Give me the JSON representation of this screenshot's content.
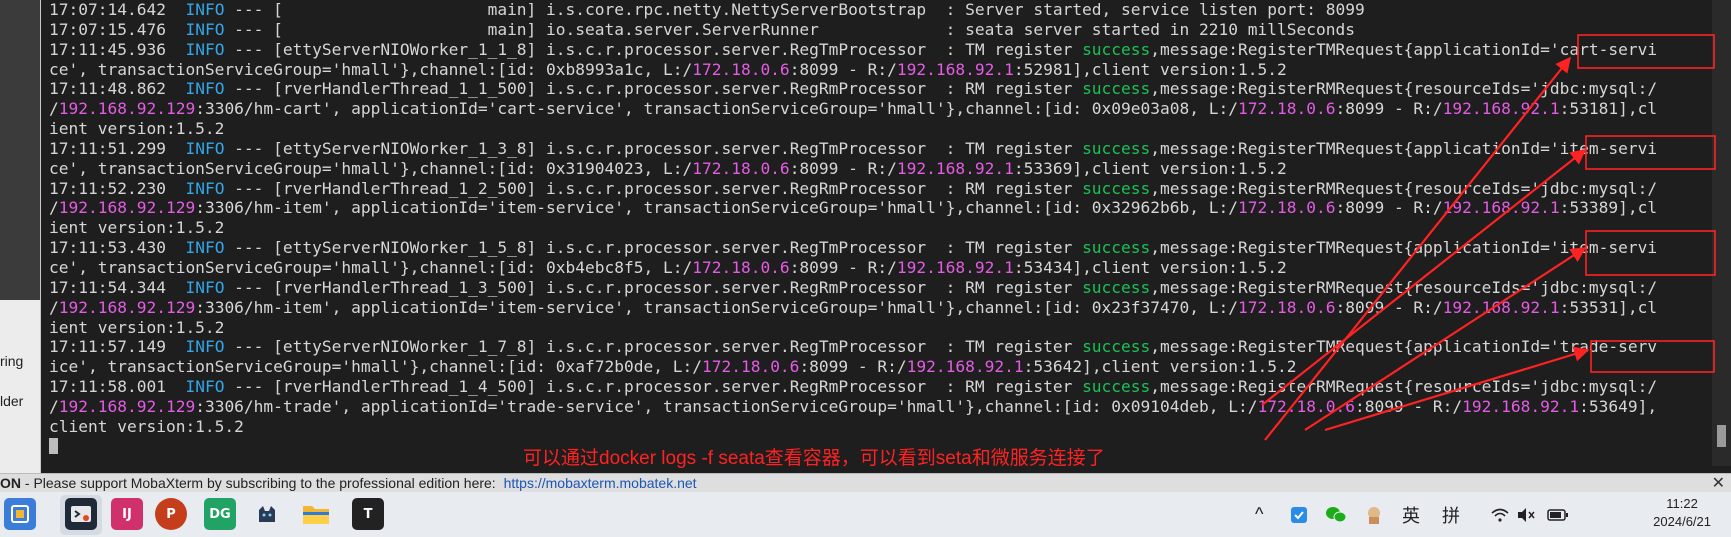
{
  "sidebar": {
    "items": [
      {
        "label": "ring"
      },
      {
        "label": "lder"
      }
    ]
  },
  "terminal": {
    "lines": [
      [
        {
          "t": "17:07:14.642  "
        },
        {
          "t": "INFO",
          "c": "info"
        },
        {
          "t": " --- [                     main] i.s.core.rpc.netty.NettyServerBootstrap  : Server started, service listen port: 8099"
        }
      ],
      [
        {
          "t": "17:07:15.476  "
        },
        {
          "t": "INFO",
          "c": "info"
        },
        {
          "t": " --- [                     main] io.seata.server.ServerRunner             : seata server started in 2210 millSeconds"
        }
      ],
      [
        {
          "t": "17:11:45.936  "
        },
        {
          "t": "INFO",
          "c": "info"
        },
        {
          "t": " --- [ettyServerNIOWorker_1_1_8] i.s.c.r.processor.server.RegTmProcessor  : TM register "
        },
        {
          "t": "success",
          "c": "ok"
        },
        {
          "t": ",message:RegisterTMRequest{applicationId='cart-servi"
        }
      ],
      [
        {
          "t": "ce', transactionServiceGroup='hmall'},channel:[id: 0xb8993a1c, L:/"
        },
        {
          "t": "172.18.0.6",
          "c": "ip"
        },
        {
          "t": ":8099 - R:/"
        },
        {
          "t": "192.168.92.1",
          "c": "ip"
        },
        {
          "t": ":52981],client version:1.5.2"
        }
      ],
      [
        {
          "t": "17:11:48.862  "
        },
        {
          "t": "INFO",
          "c": "info"
        },
        {
          "t": " --- [rverHandlerThread_1_1_500] i.s.c.r.processor.server.RegRmProcessor  : RM register "
        },
        {
          "t": "success",
          "c": "ok"
        },
        {
          "t": ",message:RegisterRMRequest{resourceIds='jdbc:mysql:/"
        }
      ],
      [
        {
          "t": "/"
        },
        {
          "t": "192.168.92.129",
          "c": "ip"
        },
        {
          "t": ":3306/hm-cart', applicationId='cart-service', transactionServiceGroup='hmall'},channel:[id: 0x09e03a08, L:/"
        },
        {
          "t": "172.18.0.6",
          "c": "ip"
        },
        {
          "t": ":8099 - R:/"
        },
        {
          "t": "192.168.92.1",
          "c": "ip"
        },
        {
          "t": ":53181],cl"
        }
      ],
      [
        {
          "t": "ient version:1.5.2"
        }
      ],
      [
        {
          "t": "17:11:51.299  "
        },
        {
          "t": "INFO",
          "c": "info"
        },
        {
          "t": " --- [ettyServerNIOWorker_1_3_8] i.s.c.r.processor.server.RegTmProcessor  : TM register "
        },
        {
          "t": "success",
          "c": "ok"
        },
        {
          "t": ",message:RegisterTMRequest{applicationId='item-servi"
        }
      ],
      [
        {
          "t": "ce', transactionServiceGroup='hmall'},channel:[id: 0x31904023, L:/"
        },
        {
          "t": "172.18.0.6",
          "c": "ip"
        },
        {
          "t": ":8099 - R:/"
        },
        {
          "t": "192.168.92.1",
          "c": "ip"
        },
        {
          "t": ":53369],client version:1.5.2"
        }
      ],
      [
        {
          "t": "17:11:52.230  "
        },
        {
          "t": "INFO",
          "c": "info"
        },
        {
          "t": " --- [rverHandlerThread_1_2_500] i.s.c.r.processor.server.RegRmProcessor  : RM register "
        },
        {
          "t": "success",
          "c": "ok"
        },
        {
          "t": ",message:RegisterRMRequest{resourceIds='jdbc:mysql:/"
        }
      ],
      [
        {
          "t": "/"
        },
        {
          "t": "192.168.92.129",
          "c": "ip"
        },
        {
          "t": ":3306/hm-item', applicationId='item-service', transactionServiceGroup='hmall'},channel:[id: 0x32962b6b, L:/"
        },
        {
          "t": "172.18.0.6",
          "c": "ip"
        },
        {
          "t": ":8099 - R:/"
        },
        {
          "t": "192.168.92.1",
          "c": "ip"
        },
        {
          "t": ":53389],cl"
        }
      ],
      [
        {
          "t": "ient version:1.5.2"
        }
      ],
      [
        {
          "t": "17:11:53.430  "
        },
        {
          "t": "INFO",
          "c": "info"
        },
        {
          "t": " --- [ettyServerNIOWorker_1_5_8] i.s.c.r.processor.server.RegTmProcessor  : TM register "
        },
        {
          "t": "success",
          "c": "ok"
        },
        {
          "t": ",message:RegisterTMRequest{applicationId='item-servi"
        }
      ],
      [
        {
          "t": "ce', transactionServiceGroup='hmall'},channel:[id: 0xb4ebc8f5, L:/"
        },
        {
          "t": "172.18.0.6",
          "c": "ip"
        },
        {
          "t": ":8099 - R:/"
        },
        {
          "t": "192.168.92.1",
          "c": "ip"
        },
        {
          "t": ":53434],client version:1.5.2"
        }
      ],
      [
        {
          "t": "17:11:54.344  "
        },
        {
          "t": "INFO",
          "c": "info"
        },
        {
          "t": " --- [rverHandlerThread_1_3_500] i.s.c.r.processor.server.RegRmProcessor  : RM register "
        },
        {
          "t": "success",
          "c": "ok"
        },
        {
          "t": ",message:RegisterRMRequest{resourceIds='jdbc:mysql:/"
        }
      ],
      [
        {
          "t": "/"
        },
        {
          "t": "192.168.92.129",
          "c": "ip"
        },
        {
          "t": ":3306/hm-item', applicationId='item-service', transactionServiceGroup='hmall'},channel:[id: 0x23f37470, L:/"
        },
        {
          "t": "172.18.0.6",
          "c": "ip"
        },
        {
          "t": ":8099 - R:/"
        },
        {
          "t": "192.168.92.1",
          "c": "ip"
        },
        {
          "t": ":53531],cl"
        }
      ],
      [
        {
          "t": "ient version:1.5.2"
        }
      ],
      [
        {
          "t": "17:11:57.149  "
        },
        {
          "t": "INFO",
          "c": "info"
        },
        {
          "t": " --- [ettyServerNIOWorker_1_7_8] i.s.c.r.processor.server.RegTmProcessor  : TM register "
        },
        {
          "t": "success",
          "c": "ok"
        },
        {
          "t": ",message:RegisterTMRequest{applicationId='trade-serv"
        }
      ],
      [
        {
          "t": "ice', transactionServiceGroup='hmall'},channel:[id: 0xaf72b0de, L:/"
        },
        {
          "t": "172.18.0.6",
          "c": "ip"
        },
        {
          "t": ":8099 - R:/"
        },
        {
          "t": "192.168.92.1",
          "c": "ip"
        },
        {
          "t": ":53642],client version:1.5.2"
        }
      ],
      [
        {
          "t": "17:11:58.001  "
        },
        {
          "t": "INFO",
          "c": "info"
        },
        {
          "t": " --- [rverHandlerThread_1_4_500] i.s.c.r.processor.server.RegRmProcessor  : RM register "
        },
        {
          "t": "success",
          "c": "ok"
        },
        {
          "t": ",message:RegisterRMRequest{resourceIds='jdbc:mysql:/"
        }
      ],
      [
        {
          "t": "/"
        },
        {
          "t": "192.168.92.129",
          "c": "ip"
        },
        {
          "t": ":3306/hm-trade', applicationId='trade-service', transactionServiceGroup='hmall'},channel:[id: 0x09104deb, L:/"
        },
        {
          "t": "172.18.0.6",
          "c": "ip"
        },
        {
          "t": ":8099 - R:/"
        },
        {
          "t": "192.168.92.1",
          "c": "ip"
        },
        {
          "t": ":53649],"
        }
      ],
      [
        {
          "t": "client version:1.5.2"
        }
      ]
    ]
  },
  "annotation": {
    "caption": "可以通过docker logs -f seata查看容器，可以看到seta和微服务连接了",
    "color": "#ff2222"
  },
  "statusbar": {
    "edition": "ON",
    "message": " -  Please support MobaXterm by subscribing to the professional edition here:  ",
    "link": "https://mobaxterm.mobatek.net",
    "close": "✕"
  },
  "taskbar": {
    "apps": [
      {
        "name": "start-app",
        "label": "",
        "bg": "#3b7dd8"
      },
      {
        "name": "mobaxterm",
        "label": "",
        "bg": "#1f2937"
      },
      {
        "name": "intellij",
        "label": "IJ",
        "bg": "#d0306b"
      },
      {
        "name": "powerpoint",
        "label": "P",
        "bg": "#c43e1c"
      },
      {
        "name": "datagrip",
        "label": "DG",
        "bg": "#21a366"
      },
      {
        "name": "cat-app",
        "label": "",
        "bg": "#e8ebf0"
      },
      {
        "name": "file-explorer",
        "label": "",
        "bg": "#f2b632"
      },
      {
        "name": "typora",
        "label": "T",
        "bg": "#222222"
      }
    ],
    "ime_lang": "英",
    "ime_mode": "拼",
    "time": "11:22",
    "date": "2024/6/21"
  },
  "colors": {
    "info": "#33a6e8",
    "success": "#19c155",
    "ip": "#e35ce3",
    "terminal_bg": "#1e1e1e"
  }
}
